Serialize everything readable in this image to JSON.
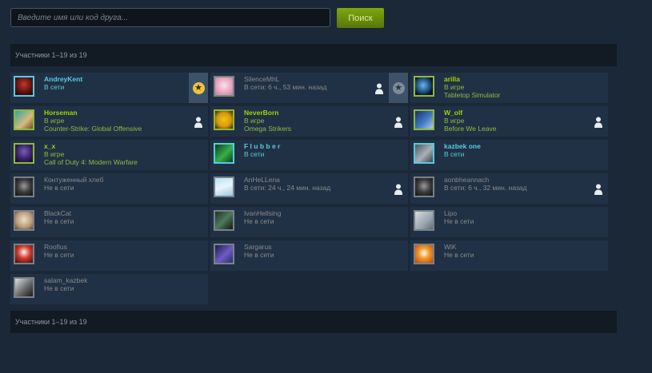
{
  "search": {
    "placeholder": "Введите имя или код друга...",
    "button_label": "Поиск"
  },
  "members_count": {
    "top": "Участники 1–19 из 19",
    "bottom": "Участники 1–19 из 19"
  },
  "colors": {
    "background": "#1b2838",
    "tile": "#213145",
    "online": "#57cbde",
    "ingame": "#90ba3c",
    "offline": "#898989",
    "search_button": "#6d9212"
  },
  "friends": [
    {
      "name": "AndreyKent",
      "line1": "В сети",
      "line2": "",
      "status": "online",
      "favorite": "gold",
      "person_icon": false,
      "avatar": "red"
    },
    {
      "name": "SilenceMhL",
      "line1": "В сети: 6 ч., 53 мин. назад",
      "line2": "",
      "status": "offline",
      "favorite": "gray",
      "person_icon": true,
      "avatar": "pink"
    },
    {
      "name": "arilla",
      "line1": "В игре",
      "line2": "Tabletop Simulator",
      "status": "ingame",
      "favorite": "",
      "person_icon": false,
      "avatar": "earth"
    },
    {
      "name": "Horseman",
      "line1": "В игре",
      "line2": "Counter-Strike: Global Offensive",
      "status": "ingame",
      "favorite": "",
      "person_icon": true,
      "avatar": "teal"
    },
    {
      "name": "NeverBorn",
      "line1": "В игре",
      "line2": "Omega Strikers",
      "status": "ingame",
      "favorite": "",
      "person_icon": true,
      "avatar": "yellow"
    },
    {
      "name": "W_olf",
      "line1": "В игре",
      "line2": "Before We Leave",
      "status": "ingame",
      "favorite": "",
      "person_icon": true,
      "avatar": "blue"
    },
    {
      "name": "x_x",
      "line1": "В игре",
      "line2": "Call of Duty 4: Modern Warfare",
      "status": "ingame",
      "favorite": "",
      "person_icon": false,
      "avatar": "purple"
    },
    {
      "name": "F l u b b e r",
      "line1": "В сети",
      "line2": "",
      "status": "online",
      "favorite": "",
      "person_icon": false,
      "avatar": "green"
    },
    {
      "name": "kazbek one",
      "line1": "В сети",
      "line2": "",
      "status": "online",
      "favorite": "",
      "person_icon": false,
      "avatar": "gray"
    },
    {
      "name": "Контуженный хлеб",
      "line1": "Не в сети",
      "line2": "",
      "status": "offline",
      "favorite": "",
      "person_icon": false,
      "avatar": "dark"
    },
    {
      "name": "AnHeLLena",
      "line1": "В сети: 24 ч., 24 мин. назад",
      "line2": "",
      "status": "offline",
      "favorite": "",
      "person_icon": true,
      "avatar": "sky"
    },
    {
      "name": "aonbheannach",
      "line1": "В сети: 6 ч., 32 мин. назад",
      "line2": "",
      "status": "offline",
      "favorite": "",
      "person_icon": true,
      "avatar": "dark"
    },
    {
      "name": "BlackCat",
      "line1": "Не в сети",
      "line2": "",
      "status": "offline",
      "favorite": "",
      "person_icon": false,
      "avatar": "beige"
    },
    {
      "name": "IvanHellsing",
      "line1": "Не в сети",
      "line2": "",
      "status": "offline",
      "favorite": "",
      "person_icon": false,
      "avatar": "forest"
    },
    {
      "name": "Lipo",
      "line1": "Не в сети",
      "line2": "",
      "status": "offline",
      "favorite": "",
      "person_icon": false,
      "avatar": "light"
    },
    {
      "name": "Roofius",
      "line1": "Не в сети",
      "line2": "",
      "status": "offline",
      "favorite": "",
      "person_icon": false,
      "avatar": "santa"
    },
    {
      "name": "Sargarus",
      "line1": "Не в сети",
      "line2": "",
      "status": "offline",
      "favorite": "",
      "person_icon": false,
      "avatar": "violet"
    },
    {
      "name": "WiK",
      "line1": "Не в сети",
      "line2": "",
      "status": "offline",
      "favorite": "",
      "person_icon": false,
      "avatar": "orange"
    },
    {
      "name": "salam_kazbek",
      "line1": "Не в сети",
      "line2": "",
      "status": "offline",
      "favorite": "",
      "person_icon": false,
      "avatar": "mono"
    }
  ],
  "icons": {
    "favorite": "star-icon",
    "person": "person-icon",
    "avatar": "avatar-icon"
  }
}
